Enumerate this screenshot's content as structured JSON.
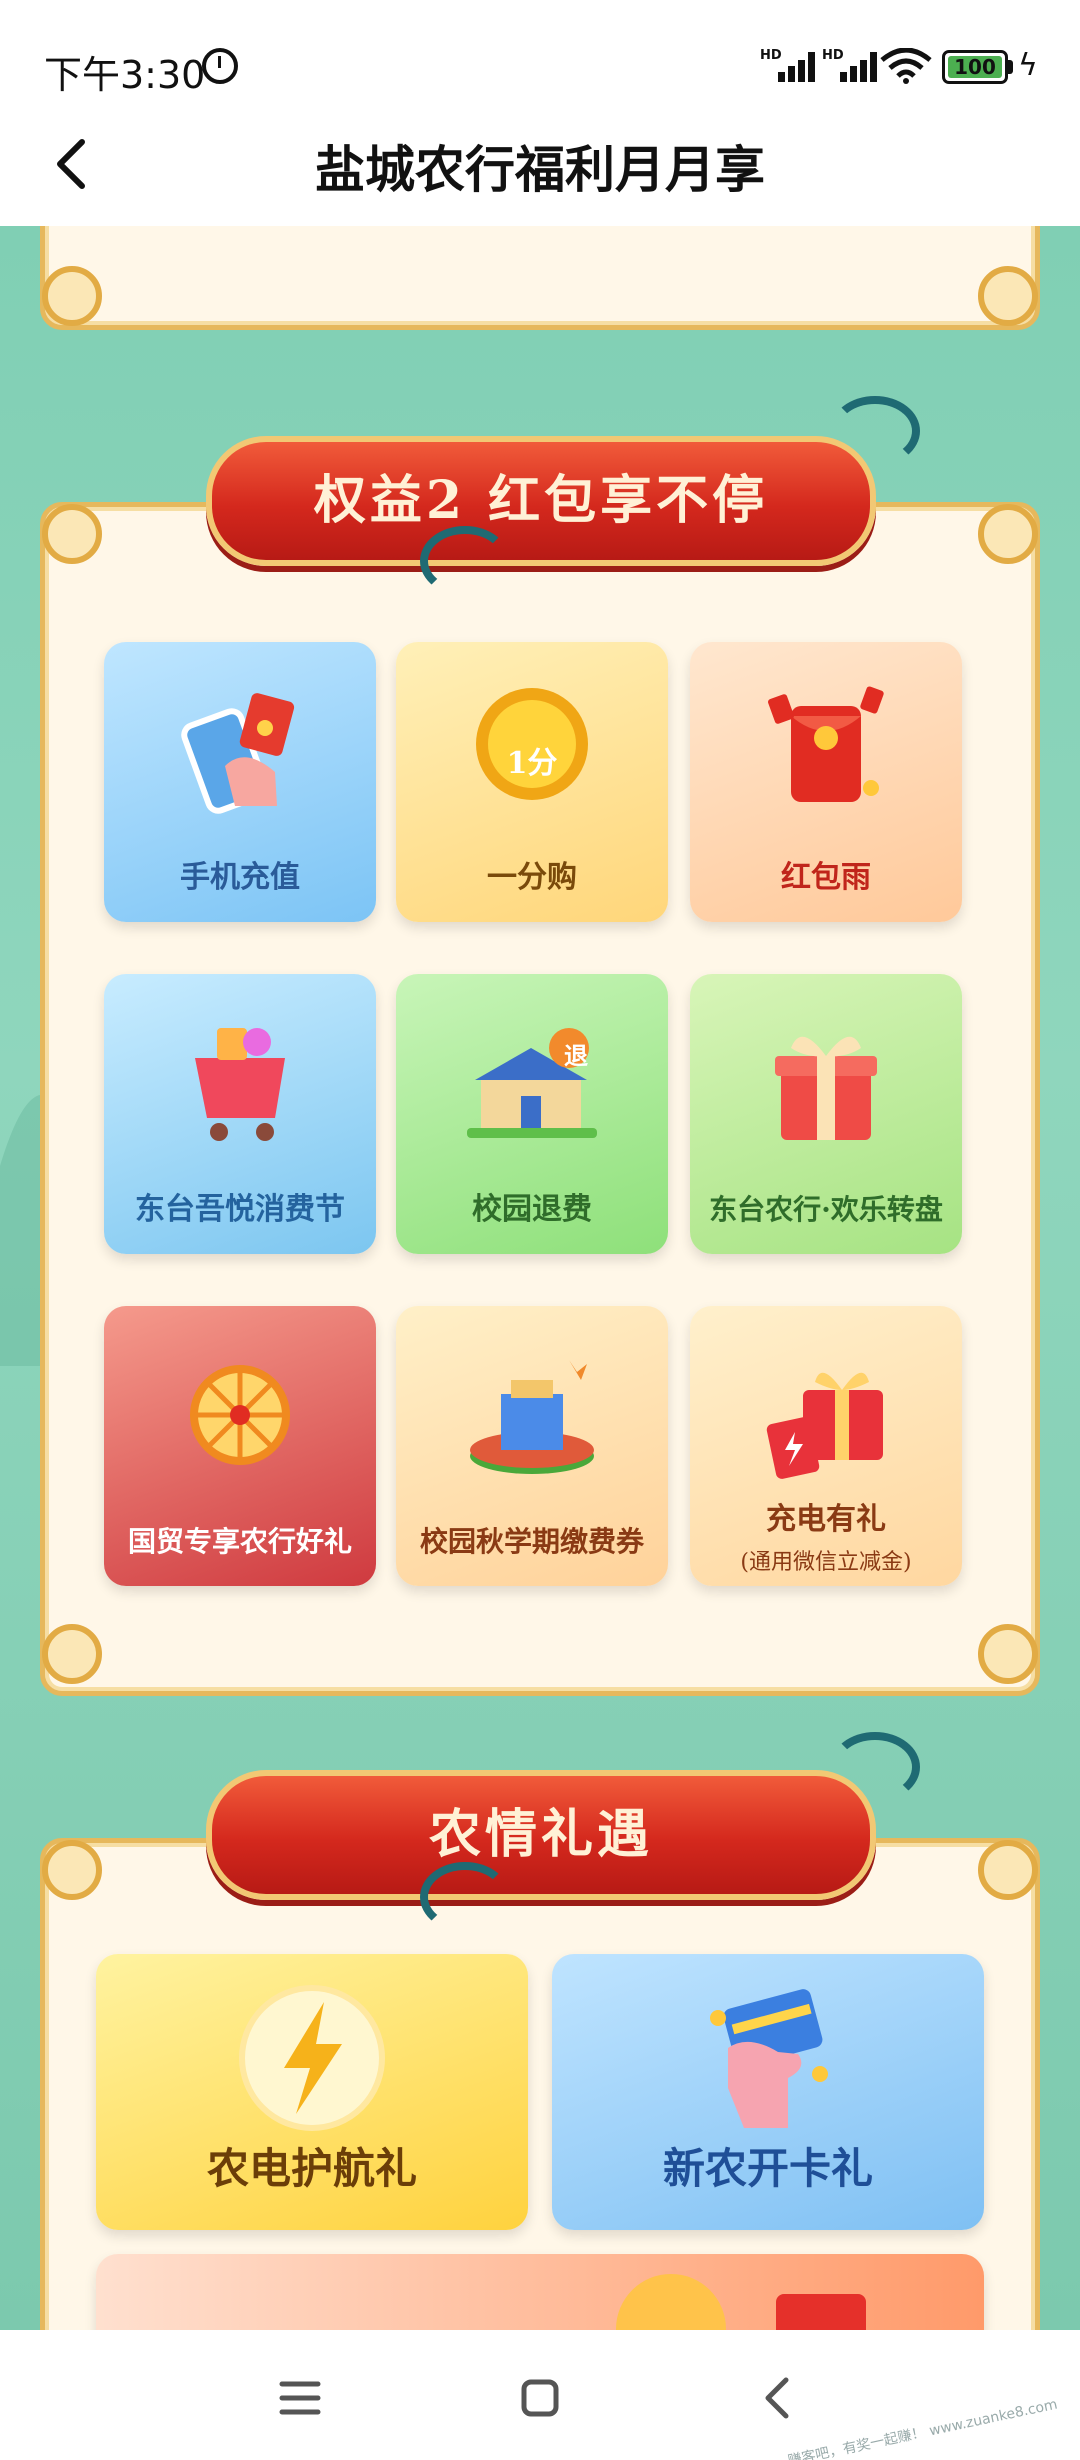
{
  "status_bar": {
    "time": "下午3:30",
    "signal_label": "HD",
    "battery_level": "100"
  },
  "header": {
    "title": "盐城农行福利月月享"
  },
  "section_2": {
    "banner": "权益2 红包享不停",
    "tiles": [
      {
        "label": "手机充值",
        "icon": "phone-topup-icon"
      },
      {
        "label": "一分购",
        "icon": "coin-icon",
        "badge": "1分"
      },
      {
        "label": "红包雨",
        "icon": "red-envelope-icon"
      },
      {
        "label": "东台吾悦消费节",
        "icon": "shopping-cart-icon"
      },
      {
        "label": "校园退费",
        "icon": "school-building-icon",
        "badge": "退"
      },
      {
        "label": "东台农行·欢乐转盘",
        "icon": "gift-box-icon"
      },
      {
        "label": "国贸专享农行好礼",
        "icon": "prize-wheel-icon"
      },
      {
        "label": "校园秋学期缴费券",
        "icon": "campus-icon"
      },
      {
        "label": "充电有礼",
        "sublabel": "(通用微信立减金)",
        "icon": "charging-gift-icon"
      }
    ]
  },
  "section_3": {
    "banner": "农情礼遇",
    "cards": [
      {
        "label": "农电护航礼",
        "icon": "lightning-icon"
      },
      {
        "label": "新农开卡礼",
        "icon": "bank-card-icon"
      }
    ]
  },
  "watermark": "赚客吧，有奖一起赚！ www.zuanke8.com",
  "colors": {
    "page_bg": "#8fd6bd",
    "banner_red": "#d4281d",
    "frame_gold": "#e6b85c"
  }
}
